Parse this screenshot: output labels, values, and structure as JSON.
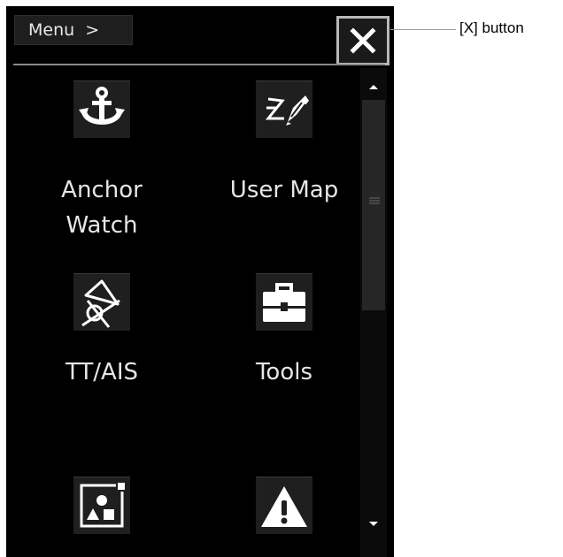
{
  "header": {
    "menu_label": "Menu >",
    "close_label": "×"
  },
  "tiles": [
    {
      "label": "Anchor\nWatch",
      "icon": "anchor-icon"
    },
    {
      "label": "User Map",
      "icon": "user-map-icon"
    },
    {
      "label": "TT/AIS",
      "icon": "tt-ais-icon"
    },
    {
      "label": "Tools",
      "icon": "toolbox-icon"
    },
    {
      "label": "",
      "icon": "display-icon"
    },
    {
      "label": "",
      "icon": "warning-icon"
    }
  ],
  "scrollbar": {
    "up_icon": "arrow-up-icon",
    "down_icon": "arrow-down-icon"
  },
  "annotation": {
    "text": "[X] button"
  },
  "colors": {
    "panel": "#000000",
    "icon_bg": "#1f1f1f",
    "text": "#e6e6e6",
    "frame": "#b8b8b8"
  }
}
